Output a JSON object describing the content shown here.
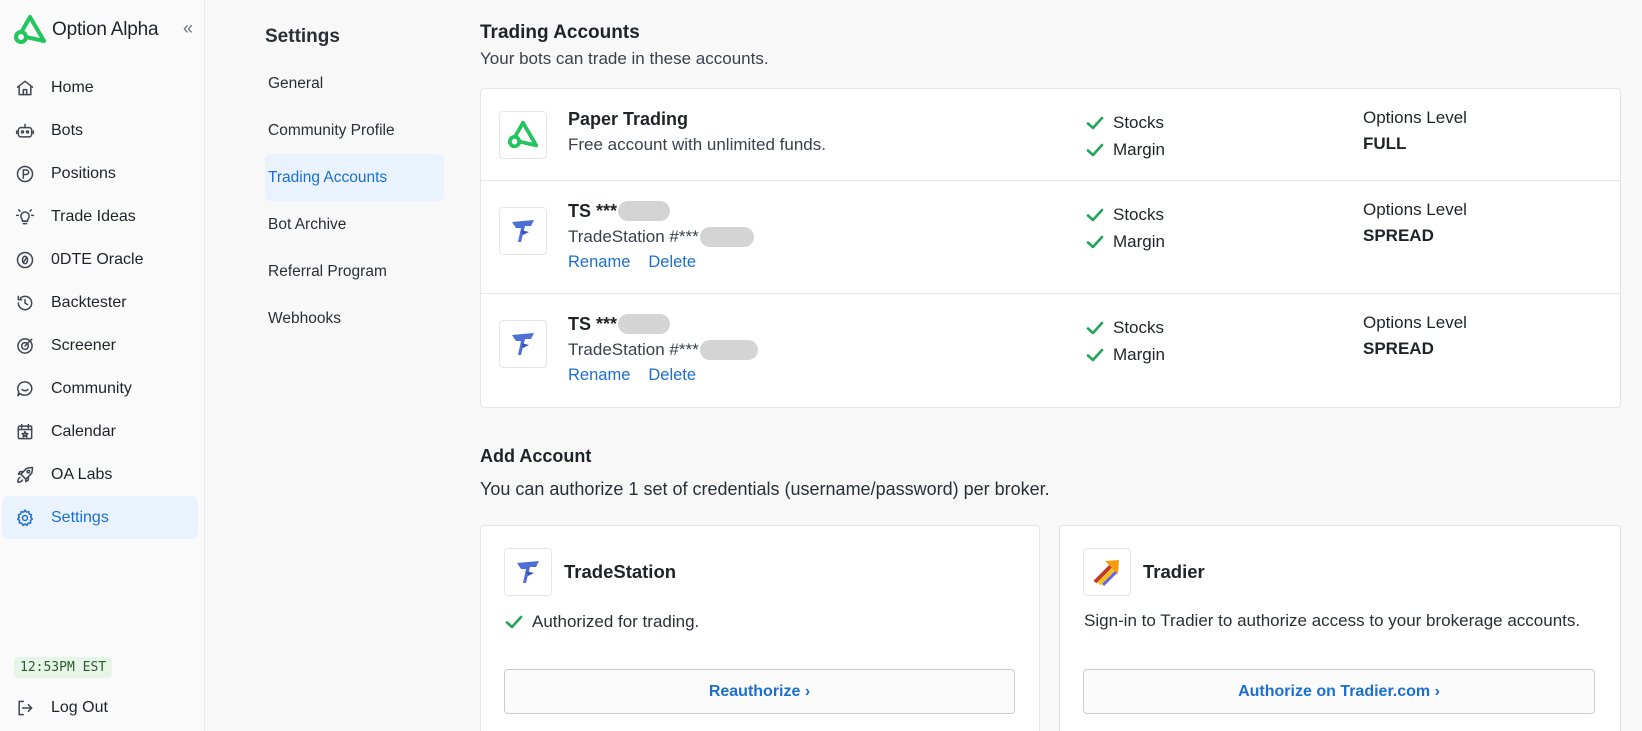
{
  "brand": {
    "name": "Option Alpha",
    "collapse_icon": "«",
    "accent": "#22c55e"
  },
  "sidebar": {
    "items": [
      {
        "label": "Home",
        "icon": "home-icon"
      },
      {
        "label": "Bots",
        "icon": "robot-icon"
      },
      {
        "label": "Positions",
        "icon": "positions-icon"
      },
      {
        "label": "Trade Ideas",
        "icon": "lightbulb-icon"
      },
      {
        "label": "0DTE Oracle",
        "icon": "zero-dte-icon"
      },
      {
        "label": "Backtester",
        "icon": "history-icon"
      },
      {
        "label": "Screener",
        "icon": "target-icon"
      },
      {
        "label": "Community",
        "icon": "chat-icon"
      },
      {
        "label": "Calendar",
        "icon": "calendar-icon"
      },
      {
        "label": "OA Labs",
        "icon": "rocket-icon"
      },
      {
        "label": "Settings",
        "icon": "gear-icon",
        "active": true
      }
    ],
    "clock": "12:53PM EST",
    "logout_label": "Log Out"
  },
  "settings_menu": {
    "title": "Settings",
    "items": [
      {
        "label": "General"
      },
      {
        "label": "Community Profile"
      },
      {
        "label": "Trading Accounts",
        "active": true
      },
      {
        "label": "Bot Archive"
      },
      {
        "label": "Referral Program"
      },
      {
        "label": "Webhooks"
      }
    ]
  },
  "trading_accounts": {
    "title": "Trading Accounts",
    "subtitle": "Your bots can trade in these accounts.",
    "accounts": [
      {
        "name": "Paper Trading",
        "description": "Free account with unlimited funds.",
        "perms": [
          "Stocks",
          "Margin"
        ],
        "level_label": "Options Level",
        "level_value": "FULL"
      },
      {
        "name": "TS ***",
        "description": "TradeStation #***",
        "rename_label": "Rename",
        "delete_label": "Delete",
        "perms": [
          "Stocks",
          "Margin"
        ],
        "level_label": "Options Level",
        "level_value": "SPREAD"
      },
      {
        "name": "TS ***",
        "description": "TradeStation #***",
        "rename_label": "Rename",
        "delete_label": "Delete",
        "perms": [
          "Stocks",
          "Margin"
        ],
        "level_label": "Options Level",
        "level_value": "SPREAD"
      }
    ]
  },
  "add_account": {
    "title": "Add Account",
    "subtitle": "You can authorize 1 set of credentials (username/password) per broker.",
    "brokers": [
      {
        "name": "TradeStation",
        "status": "Authorized for trading.",
        "button": "Reauthorize ›"
      },
      {
        "name": "Tradier",
        "text": "Sign-in to Tradier to authorize access to your brokerage accounts.",
        "button": "Authorize on Tradier.com ›"
      }
    ]
  }
}
